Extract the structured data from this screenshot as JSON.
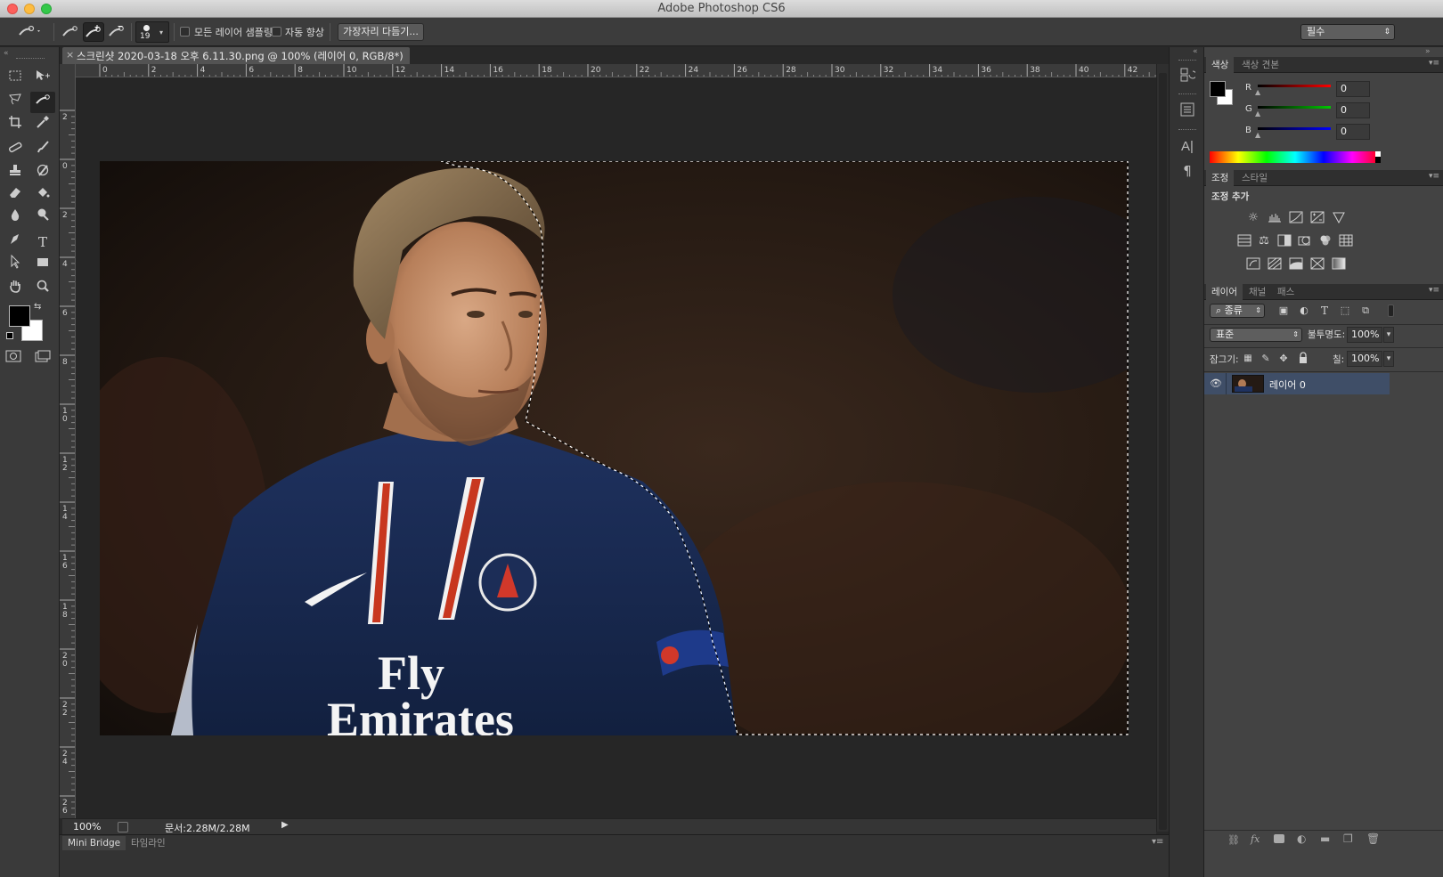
{
  "window": {
    "title": "Adobe Photoshop CS6"
  },
  "options": {
    "brush_size": "19",
    "sample_all_layers": "모든 레이어 샘플링",
    "auto_enhance": "자동 향상",
    "refine_edge": "가장자리 다듬기...",
    "workspace": "필수"
  },
  "document": {
    "tab_title": "스크린샷 2020-03-18 오후 6.11.30.png @ 100% (레이어 0, RGB/8*)",
    "zoom": "100%",
    "doc_size": "문서:2.28M/2.28M",
    "ruler_top_labels": [
      "0",
      "2",
      "4",
      "6",
      "8",
      "10",
      "12",
      "14",
      "16",
      "18",
      "20",
      "22",
      "24",
      "26",
      "28",
      "30",
      "32",
      "34",
      "36",
      "38",
      "40",
      "42"
    ],
    "ruler_left_labels": [
      "2",
      "0",
      "2",
      "4",
      "6",
      "8",
      "1 0",
      "1 2",
      "1 4",
      "1 6",
      "1 8",
      "2 0",
      "2 2",
      "2 4",
      "2 6"
    ]
  },
  "bottom_tabs": {
    "mini_bridge": "Mini Bridge",
    "timeline": "타임라인"
  },
  "color_panel": {
    "tab_color": "색상",
    "tab_swatches": "색상 견본",
    "r_label": "R",
    "g_label": "G",
    "b_label": "B",
    "r": "0",
    "g": "0",
    "b": "0"
  },
  "adjustments_panel": {
    "tab_adjustments": "조정",
    "tab_styles": "스타일",
    "heading": "조정 추가"
  },
  "layers_panel": {
    "tab_layers": "레이어",
    "tab_channels": "채널",
    "tab_paths": "패스",
    "filter_kind": "종류",
    "blend_mode": "표준",
    "opacity_label": "불투명도:",
    "opacity": "100%",
    "lock_label": "잠그기:",
    "fill_label": "칠:",
    "fill": "100%",
    "layers": [
      {
        "name": "레이어 0"
      }
    ]
  },
  "colors": {
    "accent_selected_layer": "#3f4e67",
    "foreground": "#000000",
    "background": "#ffffff"
  }
}
